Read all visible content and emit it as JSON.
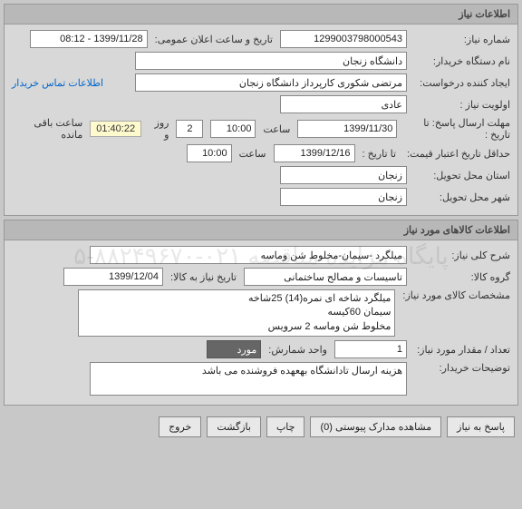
{
  "panel1": {
    "title": "اطلاعات نیاز",
    "niaz_no_label": "شماره نیاز:",
    "niaz_no": "1299003798000543",
    "announce_label": "تاریخ و ساعت اعلان عمومی:",
    "announce_value": "1399/11/28 - 08:12",
    "buyer_label": "نام دستگاه خریدار:",
    "buyer_value": "دانشگاه زنجان",
    "creator_label": "ایجاد کننده درخواست:",
    "creator_value": "مرتضی شکوری کارپرداز دانشگاه زنجان",
    "contact_link": "اطلاعات تماس خریدار",
    "priority_label": "اولویت نیاز :",
    "priority_value": "عادی",
    "deadline_label": "مهلت ارسال پاسخ:  تا تاریخ :",
    "deadline_date": "1399/11/30",
    "time_label": "ساعت",
    "deadline_time": "10:00",
    "days_value": "2",
    "days_label": "روز و",
    "timer_value": "01:40:22",
    "timer_label": "ساعت باقی مانده",
    "min_credit_label": "حداقل تاریخ اعتبار قیمت:",
    "min_credit_to": "تا تاریخ :",
    "min_credit_date": "1399/12/16",
    "min_credit_time": "10:00",
    "province_label": "استان محل تحویل:",
    "province_value": "زنجان",
    "city_label": "شهر محل تحویل:",
    "city_value": "زنجان"
  },
  "panel2": {
    "title": "اطلاعات کالاهای مورد نیاز",
    "desc_label": "شرح کلی نیاز:",
    "desc_value": "میلگرد -سیمان-مخلوط شن وماسه",
    "group_label": "گروه کالا:",
    "group_value": "تاسیسات و مصالح ساختمانی",
    "need_date_label": "تاریخ نیاز به کالا:",
    "need_date_value": "1399/12/04",
    "spec_label": "مشخصات کالای مورد نیاز:",
    "spec_value": "میلگرد شاخه ای نمره(14) 25شاخه\nسیمان 60کیسه\nمخلوط شن وماسه 2 سرویس",
    "qty_label": "تعداد / مقدار مورد نیاز:",
    "qty_value": "1",
    "unit_label": "واحد شمارش:",
    "unit_value": "مورد",
    "notes_label": "توضیحات خریدار:",
    "notes_value": "هزینه ارسال تادانشگاه بهعهده فروشنده می باشد"
  },
  "buttons": {
    "reply": "پاسخ به نیاز",
    "attach": "مشاهده مدارک پیوستی (0)",
    "print": "چاپ",
    "back": "بازگشت",
    "exit": "خروج"
  },
  "watermark": "پایگاه مزایده مناقصه\n۰۲۱-۸۸۲۴۹۶۷۰-۵"
}
